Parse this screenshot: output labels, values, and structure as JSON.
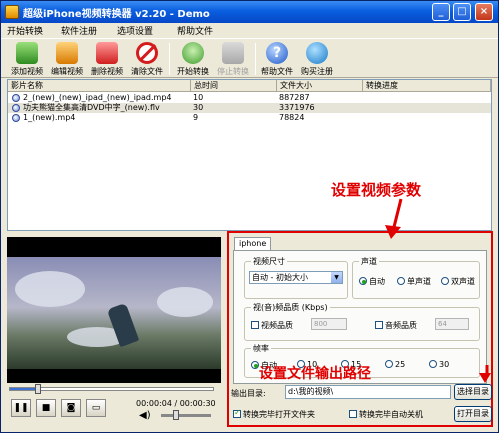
{
  "window": {
    "title": "超级iPhone视频转换器 v2.20 - Demo",
    "minimize": "_",
    "maximize": "□",
    "close": "×"
  },
  "menu": [
    "开始转换",
    "软件注册",
    "选项设置",
    "帮助文件"
  ],
  "toolbar": {
    "add": "添加视频",
    "edit": "编辑视频",
    "delete": "删除视频",
    "clear": "清除文件",
    "start": "开始转换",
    "stop": "停止转换",
    "help": "帮助文件",
    "buy": "购买注册",
    "help_glyph": "?"
  },
  "filelist": {
    "columns": [
      "影片名称",
      "总时间",
      "文件大小",
      "转换进度"
    ],
    "rows": [
      {
        "name": "2_(new)_(new)_ipad_(new)_ipad.mp4",
        "duration": "10",
        "size": "887287",
        "progress": ""
      },
      {
        "name": "功夫熊猫全集高清DVD中字_(new).flv",
        "duration": "30",
        "size": "3371976",
        "progress": ""
      },
      {
        "name": "1_(new).mp4",
        "duration": "9",
        "size": "78824",
        "progress": ""
      }
    ]
  },
  "player": {
    "time": "00:00:04 / 00:00:30",
    "seek_progress": 0.14,
    "volume": 0.3,
    "pause_glyph": "❚❚",
    "stop_glyph": "■",
    "snapshot_glyph": "◙",
    "fullscreen_glyph": "▭",
    "volume_glyph": "◀)"
  },
  "settings": {
    "tab": "iphone",
    "video_size": {
      "title": "视频尺寸",
      "selected": "自动 - 初始大小",
      "arrow": "▼"
    },
    "audio": {
      "title": "声道",
      "options": [
        "自动",
        "单声道",
        "双声道"
      ],
      "selected": 0
    },
    "quality": {
      "title": "视(音)频品质 (Kbps)",
      "video_label": "视频品质",
      "video_value": "800",
      "audio_label": "音频品质",
      "audio_value": "64"
    },
    "framerate": {
      "title": "帧率",
      "options": [
        "自动",
        "10",
        "15",
        "25",
        "30"
      ],
      "selected": 0
    },
    "output_label": "输出目录:",
    "output_path": "d:\\我的视频\\",
    "choose_button": "选择目录",
    "open_button": "打开目录",
    "open_after": "转换完毕打开文件夹",
    "open_after_checked": true,
    "shutdown_after": "转换完毕自动关机",
    "shutdown_after_checked": false
  },
  "annotations": {
    "top": "设置视频参数",
    "bottom": "设置文件输出路径"
  },
  "colors": {
    "annotation": "#e00000",
    "titlebar": "#0a5fe0"
  }
}
